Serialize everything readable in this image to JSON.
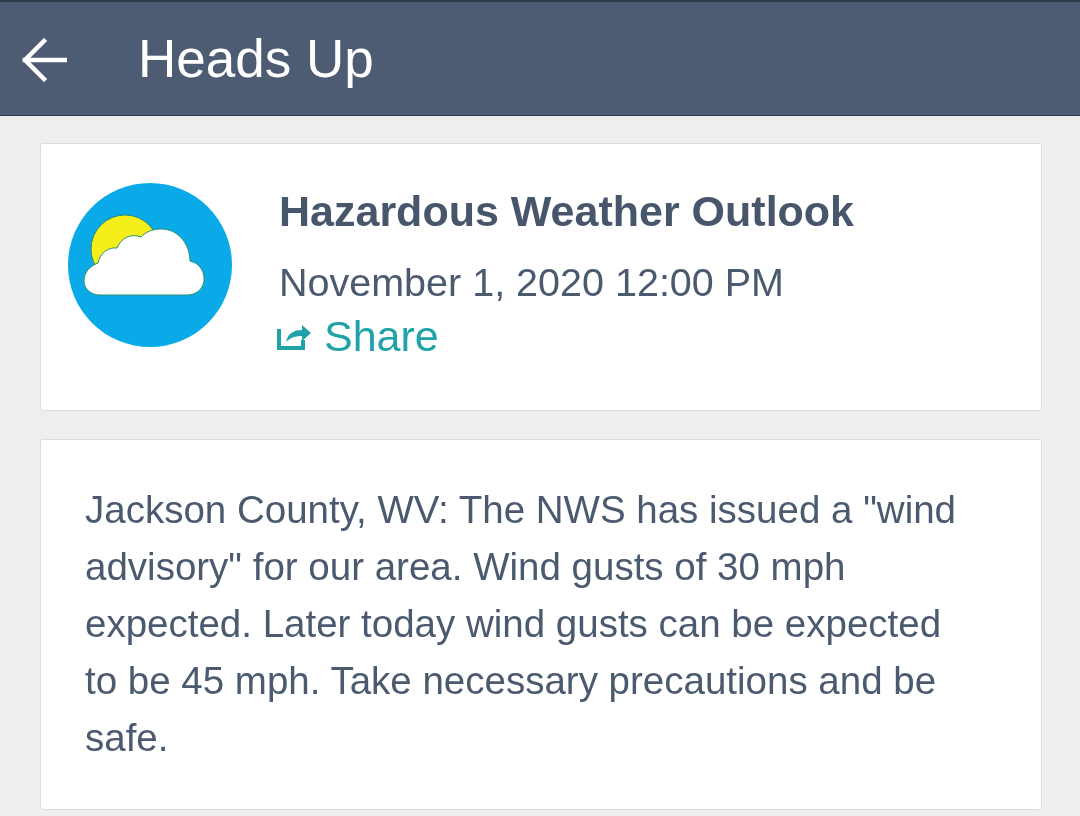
{
  "app_bar": {
    "title": "Heads Up"
  },
  "alert": {
    "title": "Hazardous Weather Outlook",
    "date": "November 1, 2020 12:00 PM",
    "share_label": "Share"
  },
  "message": {
    "text": "Jackson County, WV: The NWS has issued a \"wind advisory\" for our area. Wind gusts of 30 mph expected. Later today wind gusts can be expected to be 45 mph. Take necessary precautions and be safe."
  }
}
